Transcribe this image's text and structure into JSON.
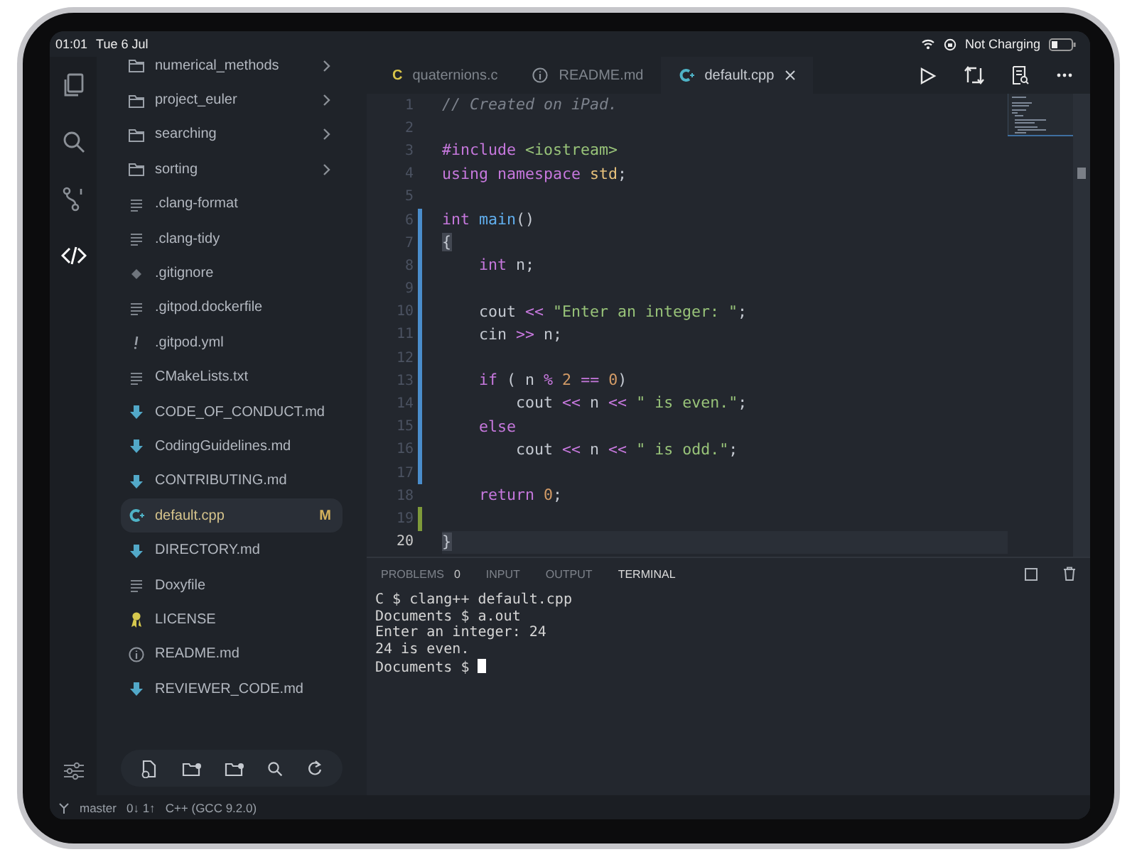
{
  "status_top": {
    "time": "01:01",
    "date": "Tue 6 Jul",
    "power": "Not Charging"
  },
  "activity_bar": [
    {
      "kind": "files",
      "selected": false
    },
    {
      "kind": "search",
      "selected": false
    },
    {
      "kind": "source-control",
      "selected": false
    },
    {
      "kind": "code",
      "selected": true
    }
  ],
  "explorer": {
    "files": [
      {
        "name": "numerical_methods",
        "kind": "folder",
        "expandable": true,
        "selected": false
      },
      {
        "name": "project_euler",
        "kind": "folder",
        "expandable": true,
        "selected": false
      },
      {
        "name": "searching",
        "kind": "folder",
        "expandable": true,
        "selected": false
      },
      {
        "name": "sorting",
        "kind": "folder",
        "expandable": true,
        "selected": false
      },
      {
        "name": ".clang-format",
        "kind": "text",
        "expandable": false,
        "selected": false
      },
      {
        "name": ".clang-tidy",
        "kind": "text",
        "expandable": false,
        "selected": false
      },
      {
        "name": ".gitignore",
        "kind": "git",
        "expandable": false,
        "selected": false
      },
      {
        "name": ".gitpod.dockerfile",
        "kind": "text",
        "expandable": false,
        "selected": false
      },
      {
        "name": ".gitpod.yml",
        "kind": "yaml",
        "expandable": false,
        "selected": false
      },
      {
        "name": "CMakeLists.txt",
        "kind": "text",
        "expandable": false,
        "selected": false
      },
      {
        "name": "CODE_OF_CONDUCT.md",
        "kind": "markdown",
        "expandable": false,
        "selected": false
      },
      {
        "name": "CodingGuidelines.md",
        "kind": "markdown",
        "expandable": false,
        "selected": false
      },
      {
        "name": "CONTRIBUTING.md",
        "kind": "markdown",
        "expandable": false,
        "selected": false
      },
      {
        "name": "default.cpp",
        "kind": "cpp",
        "expandable": false,
        "selected": true,
        "badge": "M"
      },
      {
        "name": "DIRECTORY.md",
        "kind": "markdown",
        "expandable": false,
        "selected": false
      },
      {
        "name": "Doxyfile",
        "kind": "text",
        "expandable": false,
        "selected": false
      },
      {
        "name": "LICENSE",
        "kind": "license",
        "expandable": false,
        "selected": false
      },
      {
        "name": "README.md",
        "kind": "info",
        "expandable": false,
        "selected": false
      },
      {
        "name": "REVIEWER_CODE.md",
        "kind": "markdown",
        "expandable": false,
        "selected": false
      }
    ]
  },
  "tabs": [
    {
      "label": "quaternions.c",
      "kind": "c",
      "glyph": "C",
      "selected": false
    },
    {
      "label": "README.md",
      "kind": "info",
      "selected": false
    },
    {
      "label": "default.cpp",
      "kind": "cpp",
      "selected": true
    }
  ],
  "editor": {
    "lines": [
      {
        "number": "1",
        "modified": false,
        "added": false,
        "current": false,
        "tokens": [
          {
            "kind": "comment",
            "text": "// Created on iPad."
          }
        ]
      },
      {
        "number": "2",
        "modified": false,
        "added": false,
        "current": false
      },
      {
        "number": "3",
        "modified": false,
        "added": false,
        "current": false,
        "tokens": [
          {
            "kind": "keyword",
            "text": "#include"
          },
          {
            "kind": "string",
            "text": " <iostream>"
          }
        ]
      },
      {
        "number": "4",
        "modified": false,
        "added": false,
        "current": false,
        "tokens": [
          {
            "kind": "keyword",
            "text": "using namespace"
          },
          {
            "kind": "type",
            "text": " std"
          },
          {
            "kind": "plain",
            "text": ";"
          }
        ]
      },
      {
        "number": "5",
        "modified": false,
        "added": false,
        "current": false
      },
      {
        "number": "6",
        "modified": true,
        "added": false,
        "current": false,
        "tokens": [
          {
            "kind": "keyword",
            "text": "int"
          },
          {
            "kind": "function",
            "text": " main"
          },
          {
            "kind": "plain",
            "text": "()"
          }
        ]
      },
      {
        "number": "7",
        "modified": true,
        "added": false,
        "current": false,
        "tokens": [
          {
            "kind": "bracket",
            "text": "{"
          }
        ]
      },
      {
        "number": "8",
        "modified": true,
        "added": false,
        "current": false,
        "tokens": [
          {
            "kind": "keyword",
            "text": "    int"
          },
          {
            "kind": "plain",
            "text": " n;"
          }
        ]
      },
      {
        "number": "9",
        "modified": true,
        "added": false,
        "current": false
      },
      {
        "number": "10",
        "modified": true,
        "added": false,
        "current": false,
        "tokens": [
          {
            "kind": "plain",
            "text": "    cout "
          },
          {
            "kind": "operator",
            "text": "<<"
          },
          {
            "kind": "string",
            "text": " \"Enter an integer: \""
          },
          {
            "kind": "plain",
            "text": ";"
          }
        ]
      },
      {
        "number": "11",
        "modified": true,
        "added": false,
        "current": false,
        "tokens": [
          {
            "kind": "plain",
            "text": "    cin "
          },
          {
            "kind": "operator",
            "text": ">>"
          },
          {
            "kind": "plain",
            "text": " n;"
          }
        ]
      },
      {
        "number": "12",
        "modified": true,
        "added": false,
        "current": false
      },
      {
        "number": "13",
        "modified": true,
        "added": false,
        "current": false,
        "tokens": [
          {
            "kind": "keyword",
            "text": "    if"
          },
          {
            "kind": "plain",
            "text": " ( n "
          },
          {
            "kind": "operator",
            "text": "%"
          },
          {
            "kind": "number",
            "text": " 2"
          },
          {
            "kind": "operator",
            "text": " =="
          },
          {
            "kind": "number",
            "text": " 0"
          },
          {
            "kind": "plain",
            "text": ")"
          }
        ]
      },
      {
        "number": "14",
        "modified": true,
        "added": false,
        "current": false,
        "tokens": [
          {
            "kind": "plain",
            "text": "        cout "
          },
          {
            "kind": "operator",
            "text": "<<"
          },
          {
            "kind": "plain",
            "text": " n "
          },
          {
            "kind": "operator",
            "text": "<<"
          },
          {
            "kind": "string",
            "text": " \" is even.\""
          },
          {
            "kind": "plain",
            "text": ";"
          }
        ]
      },
      {
        "number": "15",
        "modified": true,
        "added": false,
        "current": false,
        "tokens": [
          {
            "kind": "keyword",
            "text": "    else"
          }
        ]
      },
      {
        "number": "16",
        "modified": true,
        "added": false,
        "current": false,
        "tokens": [
          {
            "kind": "plain",
            "text": "        cout "
          },
          {
            "kind": "operator",
            "text": "<<"
          },
          {
            "kind": "plain",
            "text": " n "
          },
          {
            "kind": "operator",
            "text": "<<"
          },
          {
            "kind": "string",
            "text": " \" is odd.\""
          },
          {
            "kind": "plain",
            "text": ";"
          }
        ]
      },
      {
        "number": "17",
        "modified": true,
        "added": false,
        "current": false
      },
      {
        "number": "18",
        "modified": false,
        "added": false,
        "current": false,
        "tokens": [
          {
            "kind": "keyword",
            "text": "    return"
          },
          {
            "kind": "number",
            "text": " 0"
          },
          {
            "kind": "plain",
            "text": ";"
          }
        ]
      },
      {
        "number": "19",
        "modified": false,
        "added": true,
        "current": false
      },
      {
        "number": "20",
        "modified": false,
        "added": false,
        "current": true,
        "tokens": [
          {
            "kind": "bracket",
            "text": "}"
          }
        ]
      }
    ]
  },
  "panel": {
    "tabs": [
      {
        "label": "PROBLEMS",
        "count": "0",
        "selected": false
      },
      {
        "label": "INPUT",
        "selected": false
      },
      {
        "label": "OUTPUT",
        "selected": false
      },
      {
        "label": "TERMINAL",
        "selected": true
      }
    ],
    "terminal": {
      "lines": [
        "C $ clang++ default.cpp",
        "Documents $ a.out",
        "Enter an integer: 24",
        "24 is even.",
        "Documents $ "
      ],
      "cursor": true
    }
  },
  "status_bar": {
    "branch": "master",
    "sync": "0↓ 1↑",
    "language": "C++ (GCC 9.2.0)"
  }
}
